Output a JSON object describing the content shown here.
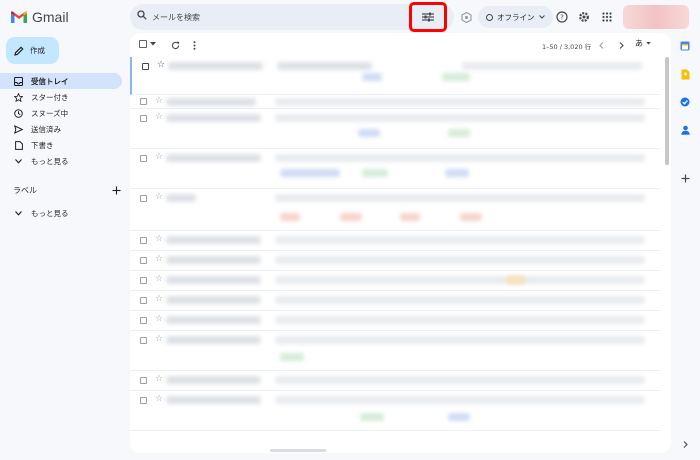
{
  "app": {
    "name": "Gmail"
  },
  "search": {
    "placeholder": "メールを検索"
  },
  "header": {
    "status_label": "オフライン"
  },
  "compose_label": "作成",
  "nav": [
    {
      "label": "受信トレイ",
      "icon": "inbox-icon",
      "active": true
    },
    {
      "label": "スター付き",
      "icon": "star-icon"
    },
    {
      "label": "スヌーズ中",
      "icon": "clock-icon"
    },
    {
      "label": "送信済み",
      "icon": "send-icon"
    },
    {
      "label": "下書き",
      "icon": "draft-icon"
    },
    {
      "label": "もっと見る",
      "icon": "chevron-down-icon"
    }
  ],
  "labels": {
    "title": "ラベル",
    "more": "もっと見る"
  },
  "toolbar": {
    "pagination": "1–50 / 3,020 行",
    "input_tool": "あ"
  },
  "colors": {
    "accent": "#0b57d0",
    "compose": "#c2e7ff",
    "active_nav": "#d3e3fd",
    "highlight": "#ff0000"
  }
}
